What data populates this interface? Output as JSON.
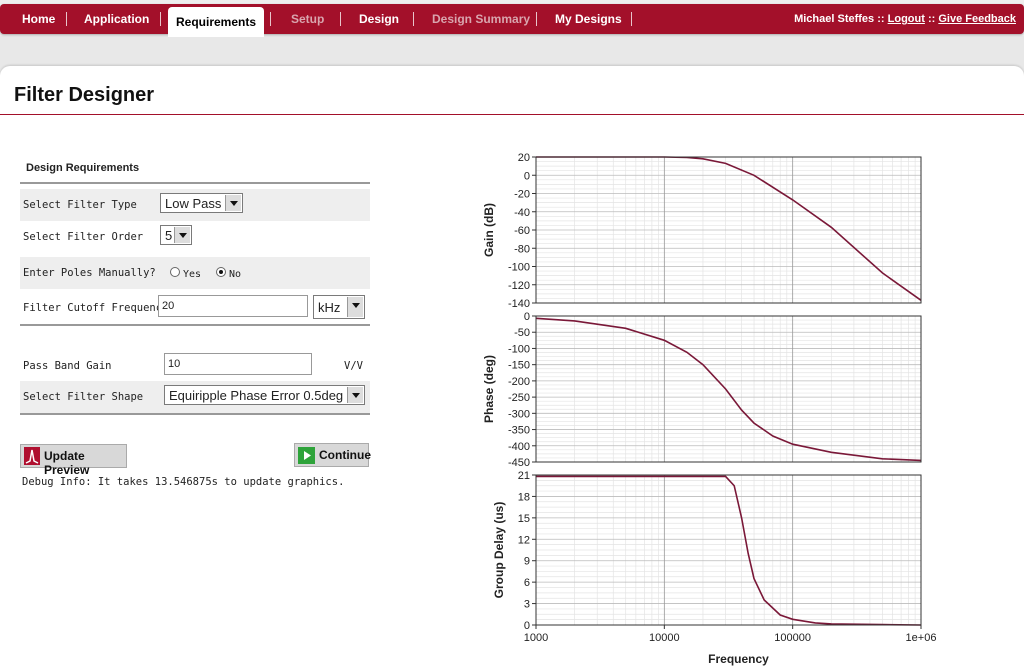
{
  "nav": {
    "items": [
      {
        "label": "Home",
        "state": "normal"
      },
      {
        "label": "Application",
        "state": "normal"
      },
      {
        "label": "Requirements",
        "state": "active"
      },
      {
        "label": "Setup",
        "state": "disabled"
      },
      {
        "label": "Design",
        "state": "normal"
      },
      {
        "label": "Design Summary",
        "state": "disabled"
      },
      {
        "label": "My Designs",
        "state": "normal"
      }
    ],
    "user_name": "Michael Steffes",
    "separator": " :: ",
    "logout": "Logout",
    "feedback": "Give Feedback"
  },
  "page": {
    "title": "Filter Designer"
  },
  "form": {
    "section_title": "Design Requirements",
    "filter_type": {
      "label": "Select Filter Type",
      "value": "Low Pass"
    },
    "filter_order": {
      "label": "Select Filter Order",
      "value": "5"
    },
    "poles_manual": {
      "label": "Enter Poles Manually?",
      "options": [
        "Yes",
        "No"
      ],
      "selected": "No"
    },
    "cutoff": {
      "label": "Filter Cutoff Frequency",
      "value": "20",
      "unit": "kHz"
    },
    "pass_band_gain": {
      "label": "Pass Band Gain",
      "value": "10",
      "unit": "V/V"
    },
    "filter_shape": {
      "label": "Select Filter Shape",
      "value": "Equiripple Phase Error 0.5deg"
    },
    "update_button": "Update Preview",
    "continue_button": "Continue",
    "debug_info": "Debug Info: It takes 13.546875s to update graphics."
  },
  "colors": {
    "accent": "#a3102a",
    "curve": "#7a1838"
  },
  "chart_data": [
    {
      "type": "line",
      "ylabel": "Gain (dB)",
      "xscale": "log",
      "xlim": [
        1000,
        1000000
      ],
      "ylim": [
        -140,
        20
      ],
      "yticks": [
        20,
        0,
        -20,
        -40,
        -60,
        -80,
        -100,
        -120,
        -140
      ],
      "grid": true,
      "series": [
        {
          "x": [
            1000,
            5000,
            10000,
            15000,
            20000,
            30000,
            50000,
            100000,
            200000,
            500000,
            1000000
          ],
          "y": [
            20,
            20,
            20,
            19.5,
            18,
            13,
            0,
            -27,
            -57,
            -107,
            -137
          ]
        }
      ]
    },
    {
      "type": "line",
      "ylabel": "Phase (deg)",
      "xscale": "log",
      "xlim": [
        1000,
        1000000
      ],
      "ylim": [
        -450,
        0
      ],
      "yticks": [
        0,
        -50,
        -100,
        -150,
        -200,
        -250,
        -300,
        -350,
        -400,
        -450
      ],
      "grid": true,
      "series": [
        {
          "x": [
            1000,
            2000,
            5000,
            10000,
            15000,
            20000,
            30000,
            40000,
            50000,
            70000,
            100000,
            200000,
            500000,
            1000000
          ],
          "y": [
            -7,
            -15,
            -38,
            -75,
            -112,
            -150,
            -225,
            -290,
            -330,
            -370,
            -395,
            -420,
            -440,
            -445
          ]
        }
      ]
    },
    {
      "type": "line",
      "ylabel": "Group Delay (us)",
      "xlabel": "Frequency",
      "xscale": "log",
      "xlim": [
        1000,
        1000000
      ],
      "ylim": [
        0,
        21
      ],
      "yticks": [
        21,
        18,
        15,
        12,
        9,
        6,
        3,
        0
      ],
      "xticks": [
        "1000",
        "10000",
        "100000",
        "1e+06"
      ],
      "grid": true,
      "series": [
        {
          "x": [
            1000,
            10000,
            20000,
            30000,
            35000,
            40000,
            45000,
            50000,
            60000,
            80000,
            100000,
            150000,
            200000,
            500000,
            1000000
          ],
          "y": [
            20.8,
            20.8,
            20.8,
            20.8,
            19.5,
            15,
            10,
            6.5,
            3.5,
            1.4,
            0.8,
            0.3,
            0.15,
            0.05,
            0
          ]
        }
      ]
    }
  ]
}
